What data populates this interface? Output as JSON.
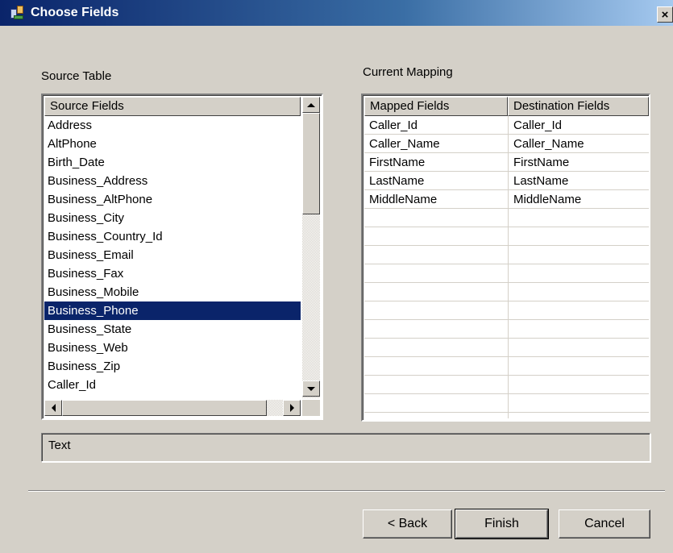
{
  "window": {
    "title": "Choose Fields",
    "close_glyph": "×"
  },
  "source": {
    "label": "Source Table",
    "header": "Source Fields",
    "items": [
      "Address",
      "AltPhone",
      "Birth_Date",
      "Business_Address",
      "Business_AltPhone",
      "Business_City",
      "Business_Country_Id",
      "Business_Email",
      "Business_Fax",
      "Business_Mobile",
      "Business_Phone",
      "Business_State",
      "Business_Web",
      "Business_Zip",
      "Caller_Id"
    ],
    "selected_index": 10
  },
  "mapping": {
    "label": "Current Mapping",
    "headers": [
      "Mapped Fields",
      "Destination Fields"
    ],
    "rows": [
      [
        "Caller_Id",
        "Caller_Id"
      ],
      [
        "Caller_Name",
        "Caller_Name"
      ],
      [
        "FirstName",
        "FirstName"
      ],
      [
        "LastName",
        "LastName"
      ],
      [
        "MiddleName",
        "MiddleName"
      ]
    ]
  },
  "description": {
    "text": "Text"
  },
  "buttons": {
    "back": "< Back",
    "finish": "Finish",
    "cancel": "Cancel"
  },
  "colors": {
    "selection": "#0a246a",
    "dialog_bg": "#d4d0c8",
    "title_start": "#0a246a",
    "title_end": "#a6caf0"
  }
}
